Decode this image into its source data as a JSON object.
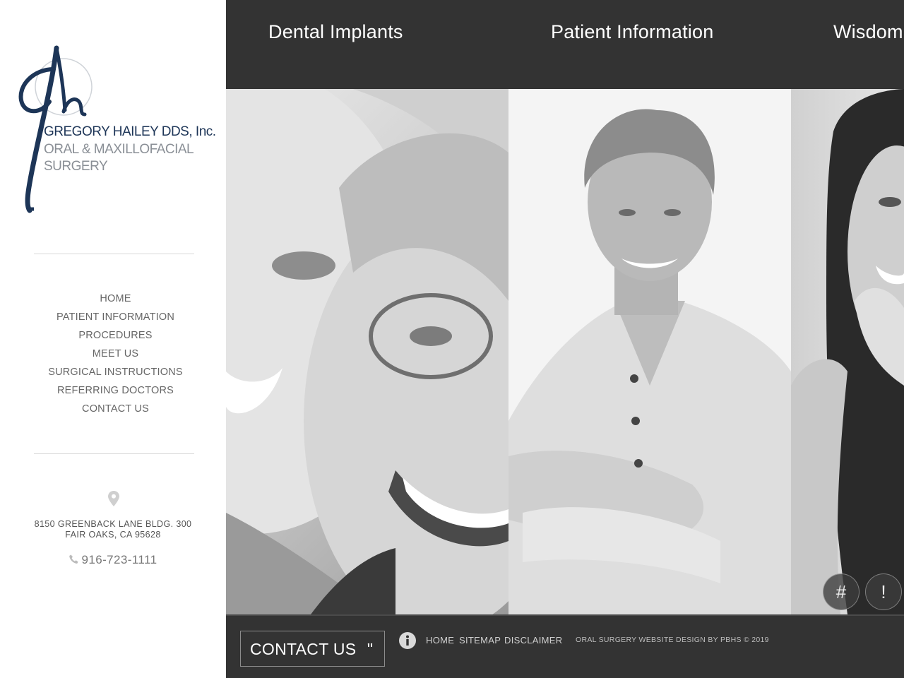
{
  "logo": {
    "line1": "GREGORY HAILEY DDS, Inc.",
    "line2": "ORAL & MAXILLOFACIAL",
    "line3": "SURGERY"
  },
  "nav": {
    "items": [
      {
        "label": "HOME"
      },
      {
        "label": "PATIENT INFORMATION"
      },
      {
        "label": "PROCEDURES"
      },
      {
        "label": "MEET US"
      },
      {
        "label": "SURGICAL INSTRUCTIONS"
      },
      {
        "label": "REFERRING DOCTORS"
      },
      {
        "label": "CONTACT US"
      }
    ]
  },
  "address": {
    "line1": "8150 GREENBACK LANE BLDG. 300",
    "line2": "FAIR OAKS, CA 95628",
    "phone": "916-723-1111"
  },
  "panels": [
    {
      "title": "Dental Implants"
    },
    {
      "title": "Patient Information"
    },
    {
      "title": "Wisdom"
    }
  ],
  "floating_buttons": {
    "hash": "#",
    "exclaim": "!"
  },
  "footer": {
    "contact_label": "CONTACT US",
    "contact_quote": "\"",
    "links": {
      "home": "HOME",
      "sitemap": "SITEMAP",
      "disclaimer": "DISCLAIMER"
    },
    "credit": "ORAL SURGERY WEBSITE DESIGN BY PBHS © 2019"
  },
  "colors": {
    "dark_bg": "#333333",
    "logo_blue": "#1d3557",
    "logo_gray": "#8a8f96"
  },
  "icons": [
    "map-pin-icon",
    "phone-icon",
    "info-icon"
  ]
}
